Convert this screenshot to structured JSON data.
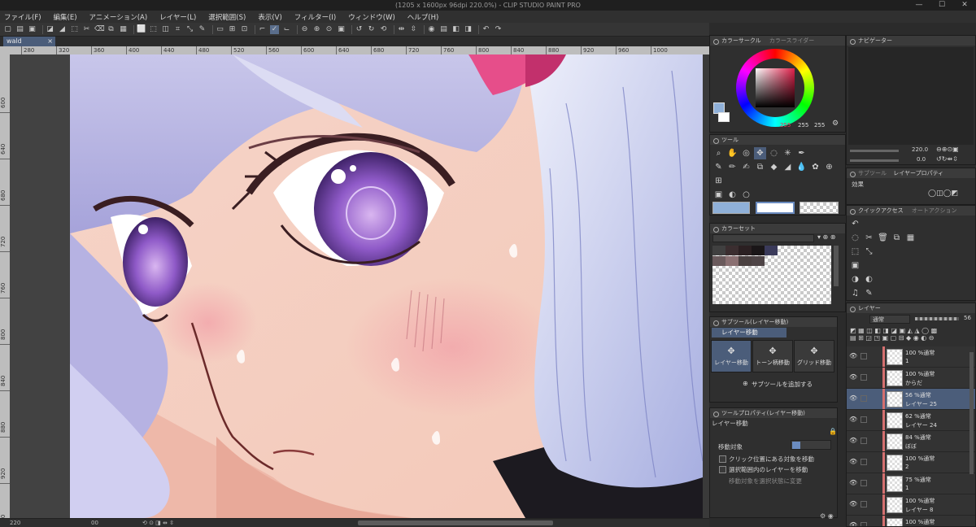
{
  "window": {
    "title": "(1205 x 1600px 96dpi 220.0%) - CLIP STUDIO PAINT PRO",
    "min": "—",
    "max": "☐",
    "close": "✕"
  },
  "menu": [
    "ファイル(F)",
    "編集(E)",
    "アニメーション(A)",
    "レイヤー(L)",
    "選択範囲(S)",
    "表示(V)",
    "フィルター(I)",
    "ウィンドウ(W)",
    "ヘルプ(H)"
  ],
  "document_tab": {
    "name": "wald",
    "close": "×"
  },
  "ruler": {
    "h": [
      "280",
      "320",
      "360",
      "400",
      "440",
      "480",
      "520",
      "560",
      "600",
      "640",
      "680",
      "720",
      "760",
      "800",
      "840",
      "880",
      "920",
      "960",
      "1000"
    ],
    "v": [
      "600",
      "640",
      "680",
      "720",
      "760",
      "800",
      "840",
      "880",
      "920",
      "960"
    ]
  },
  "status": {
    "zoom": "220",
    "angle": "0.0",
    "extra": "00"
  },
  "color_circle": {
    "tab1": "カラーサークル",
    "tab2": "カラースライダー",
    "r": "255",
    "g": "255",
    "b": "255",
    "main_color": "#8fb0d8",
    "sub_color": "#ffffff"
  },
  "tool_panel": {
    "title": "ツール"
  },
  "color_set": {
    "title": "カラーセット"
  },
  "subtool": {
    "title": "サブツール(レイヤー移動)",
    "group": "レイヤー移動",
    "items": [
      "レイヤー移動",
      "トーン柄移動",
      "グリッド移動"
    ],
    "add": "サブツールを追加する"
  },
  "tool_property": {
    "title": "ツールプロパティ(レイヤー移動)",
    "name": "レイヤー移動",
    "target_label": "移動対象",
    "opt1": "クリック位置にある対象を移動",
    "opt2": "選択範囲内のレイヤーを移動",
    "opt3": "移動対象を選択状態に変更"
  },
  "navigator": {
    "title": "ナビゲーター",
    "zoom": "220.0",
    "angle": "0.0"
  },
  "layer_property": {
    "tab1": "サブツール",
    "tab2": "レイヤープロパティ",
    "effect": "効果"
  },
  "quick_access": {
    "tab1": "クイックアクセス",
    "tab2": "オートアクション"
  },
  "layers": {
    "title": "レイヤー",
    "blend": "通常",
    "opacity": "56",
    "items": [
      {
        "l1": "100 %通常",
        "l2": "1",
        "sel": false
      },
      {
        "l1": "100 %通常",
        "l2": "からだ",
        "sel": false
      },
      {
        "l1": "56 %通常",
        "l2": "レイヤー 25",
        "sel": true
      },
      {
        "l1": "62 %通常",
        "l2": "レイヤー 24",
        "sel": false
      },
      {
        "l1": "84 %通常",
        "l2": "ぼぼ",
        "sel": false
      },
      {
        "l1": "100 %通常",
        "l2": "2",
        "sel": false
      },
      {
        "l1": "75 %通常",
        "l2": "1",
        "sel": false
      },
      {
        "l1": "100 %通常",
        "l2": "レイヤー 8",
        "sel": false
      },
      {
        "l1": "100 %通常",
        "l2": "",
        "sel": false
      }
    ]
  }
}
